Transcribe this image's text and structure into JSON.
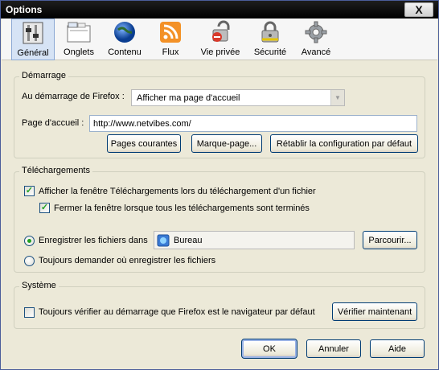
{
  "window": {
    "title": "Options",
    "close_glyph": "X"
  },
  "toolbar": {
    "items": [
      {
        "label": "Général",
        "icon": "general-switch-icon"
      },
      {
        "label": "Onglets",
        "icon": "tabs-icon"
      },
      {
        "label": "Contenu",
        "icon": "globe-icon"
      },
      {
        "label": "Flux",
        "icon": "rss-feed-icon"
      },
      {
        "label": "Vie privée",
        "icon": "privacy-lock-icon"
      },
      {
        "label": "Sécurité",
        "icon": "padlock-icon"
      },
      {
        "label": "Avancé",
        "icon": "gear-icon"
      }
    ],
    "selected": "Général"
  },
  "startup": {
    "legend": "Démarrage",
    "when_label": "Au démarrage de Firefox :",
    "when_value": "Afficher ma page d'accueil",
    "homepage_label": "Page d'accueil :",
    "homepage_value": "http://www.netvibes.com/",
    "btn_current": "Pages courantes",
    "btn_bookmark": "Marque-page...",
    "btn_restore": "Rétablir la configuration par défaut"
  },
  "downloads": {
    "legend": "Téléchargements",
    "show_window_label": "Afficher la fenêtre Téléchargements lors du téléchargement d'un fichier",
    "show_window_checked": true,
    "close_window_label": "Fermer la fenêtre lorsque tous les téléchargements sont terminés",
    "close_window_checked": true,
    "save_to_label": "Enregistrer les fichiers dans",
    "save_to_selected": true,
    "folder_name": "Bureau",
    "browse_label": "Parcourir...",
    "always_ask_label": "Toujours demander où enregistrer les fichiers"
  },
  "system": {
    "legend": "Système",
    "default_check_label": "Toujours vérifier au démarrage que Firefox est le navigateur par défaut",
    "default_check_checked": false,
    "check_now_label": "Vérifier maintenant"
  },
  "footer": {
    "ok": "OK",
    "cancel": "Annuler",
    "help": "Aide"
  }
}
